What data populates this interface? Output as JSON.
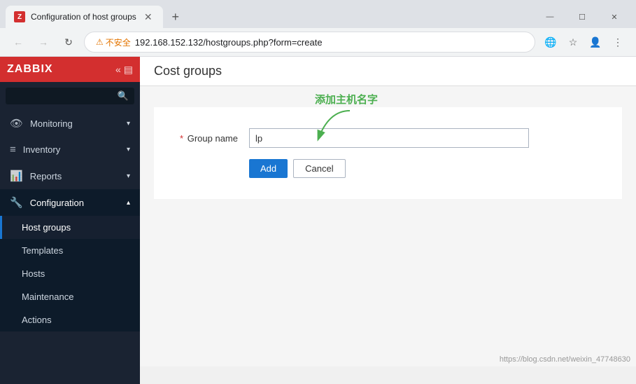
{
  "browser": {
    "tab_title": "Configuration of host groups",
    "url": "192.168.152.132/hostgroups.php?form=create",
    "insecure_label": "不安全",
    "favicon_letter": "Z"
  },
  "page": {
    "title": "ost groups"
  },
  "annotation": {
    "text": "添加主机名字"
  },
  "form": {
    "group_name_label": "* Group name",
    "group_name_placeholder": "lp",
    "group_name_value": "lp",
    "add_button": "Add",
    "cancel_button": "Cancel"
  },
  "sidebar": {
    "logo": "ZABBIX",
    "search_placeholder": "",
    "items": [
      {
        "id": "monitoring",
        "label": "Monitoring",
        "icon": "👁",
        "has_arrow": true,
        "active": false
      },
      {
        "id": "inventory",
        "label": "Inventory",
        "icon": "☰",
        "has_arrow": true,
        "active": false
      },
      {
        "id": "reports",
        "label": "Reports",
        "icon": "📊",
        "has_arrow": true,
        "active": false
      },
      {
        "id": "configuration",
        "label": "Configuration",
        "icon": "🔧",
        "has_arrow": true,
        "active": true
      }
    ],
    "sub_items": [
      {
        "id": "host-groups",
        "label": "Host groups",
        "active": true
      },
      {
        "id": "templates",
        "label": "Templates",
        "active": false
      },
      {
        "id": "hosts",
        "label": "Hosts",
        "active": false
      },
      {
        "id": "maintenance",
        "label": "Maintenance",
        "active": false
      },
      {
        "id": "actions",
        "label": "Actions",
        "active": false
      }
    ]
  },
  "footer": {
    "link": "https://blog.csdn.net/weixin_47748630"
  }
}
